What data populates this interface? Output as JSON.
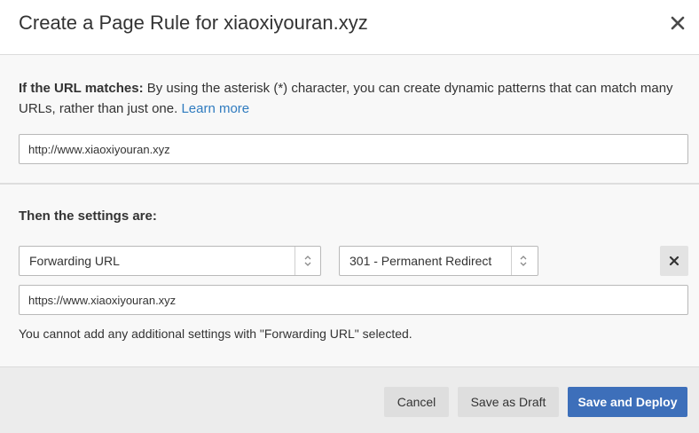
{
  "dialog": {
    "title": "Create a Page Rule for xiaoxiyouran.xyz",
    "close_icon": "close-icon"
  },
  "match": {
    "heading": "If the URL matches:",
    "description": " By using the asterisk (*) character, you can create dynamic patterns that can match many URLs, rather than just one. ",
    "learn_more": "Learn more",
    "url_value": "http://www.xiaoxiyouran.xyz"
  },
  "settings": {
    "heading": "Then the settings are:",
    "setting_selected": "Forwarding URL",
    "status_selected": "301 - Permanent Redirect",
    "forward_url_value": "https://www.xiaoxiyouran.xyz",
    "note": "You cannot add any additional settings with \"Forwarding URL\" selected.",
    "remove_icon": "remove-icon"
  },
  "footer": {
    "cancel_label": "Cancel",
    "draft_label": "Save as Draft",
    "deploy_label": "Save and Deploy"
  },
  "colors": {
    "primary_button": "#3d6fba",
    "link": "#2f7bbf",
    "section_background": "#f8f8f8",
    "footer_background": "#ececec"
  }
}
